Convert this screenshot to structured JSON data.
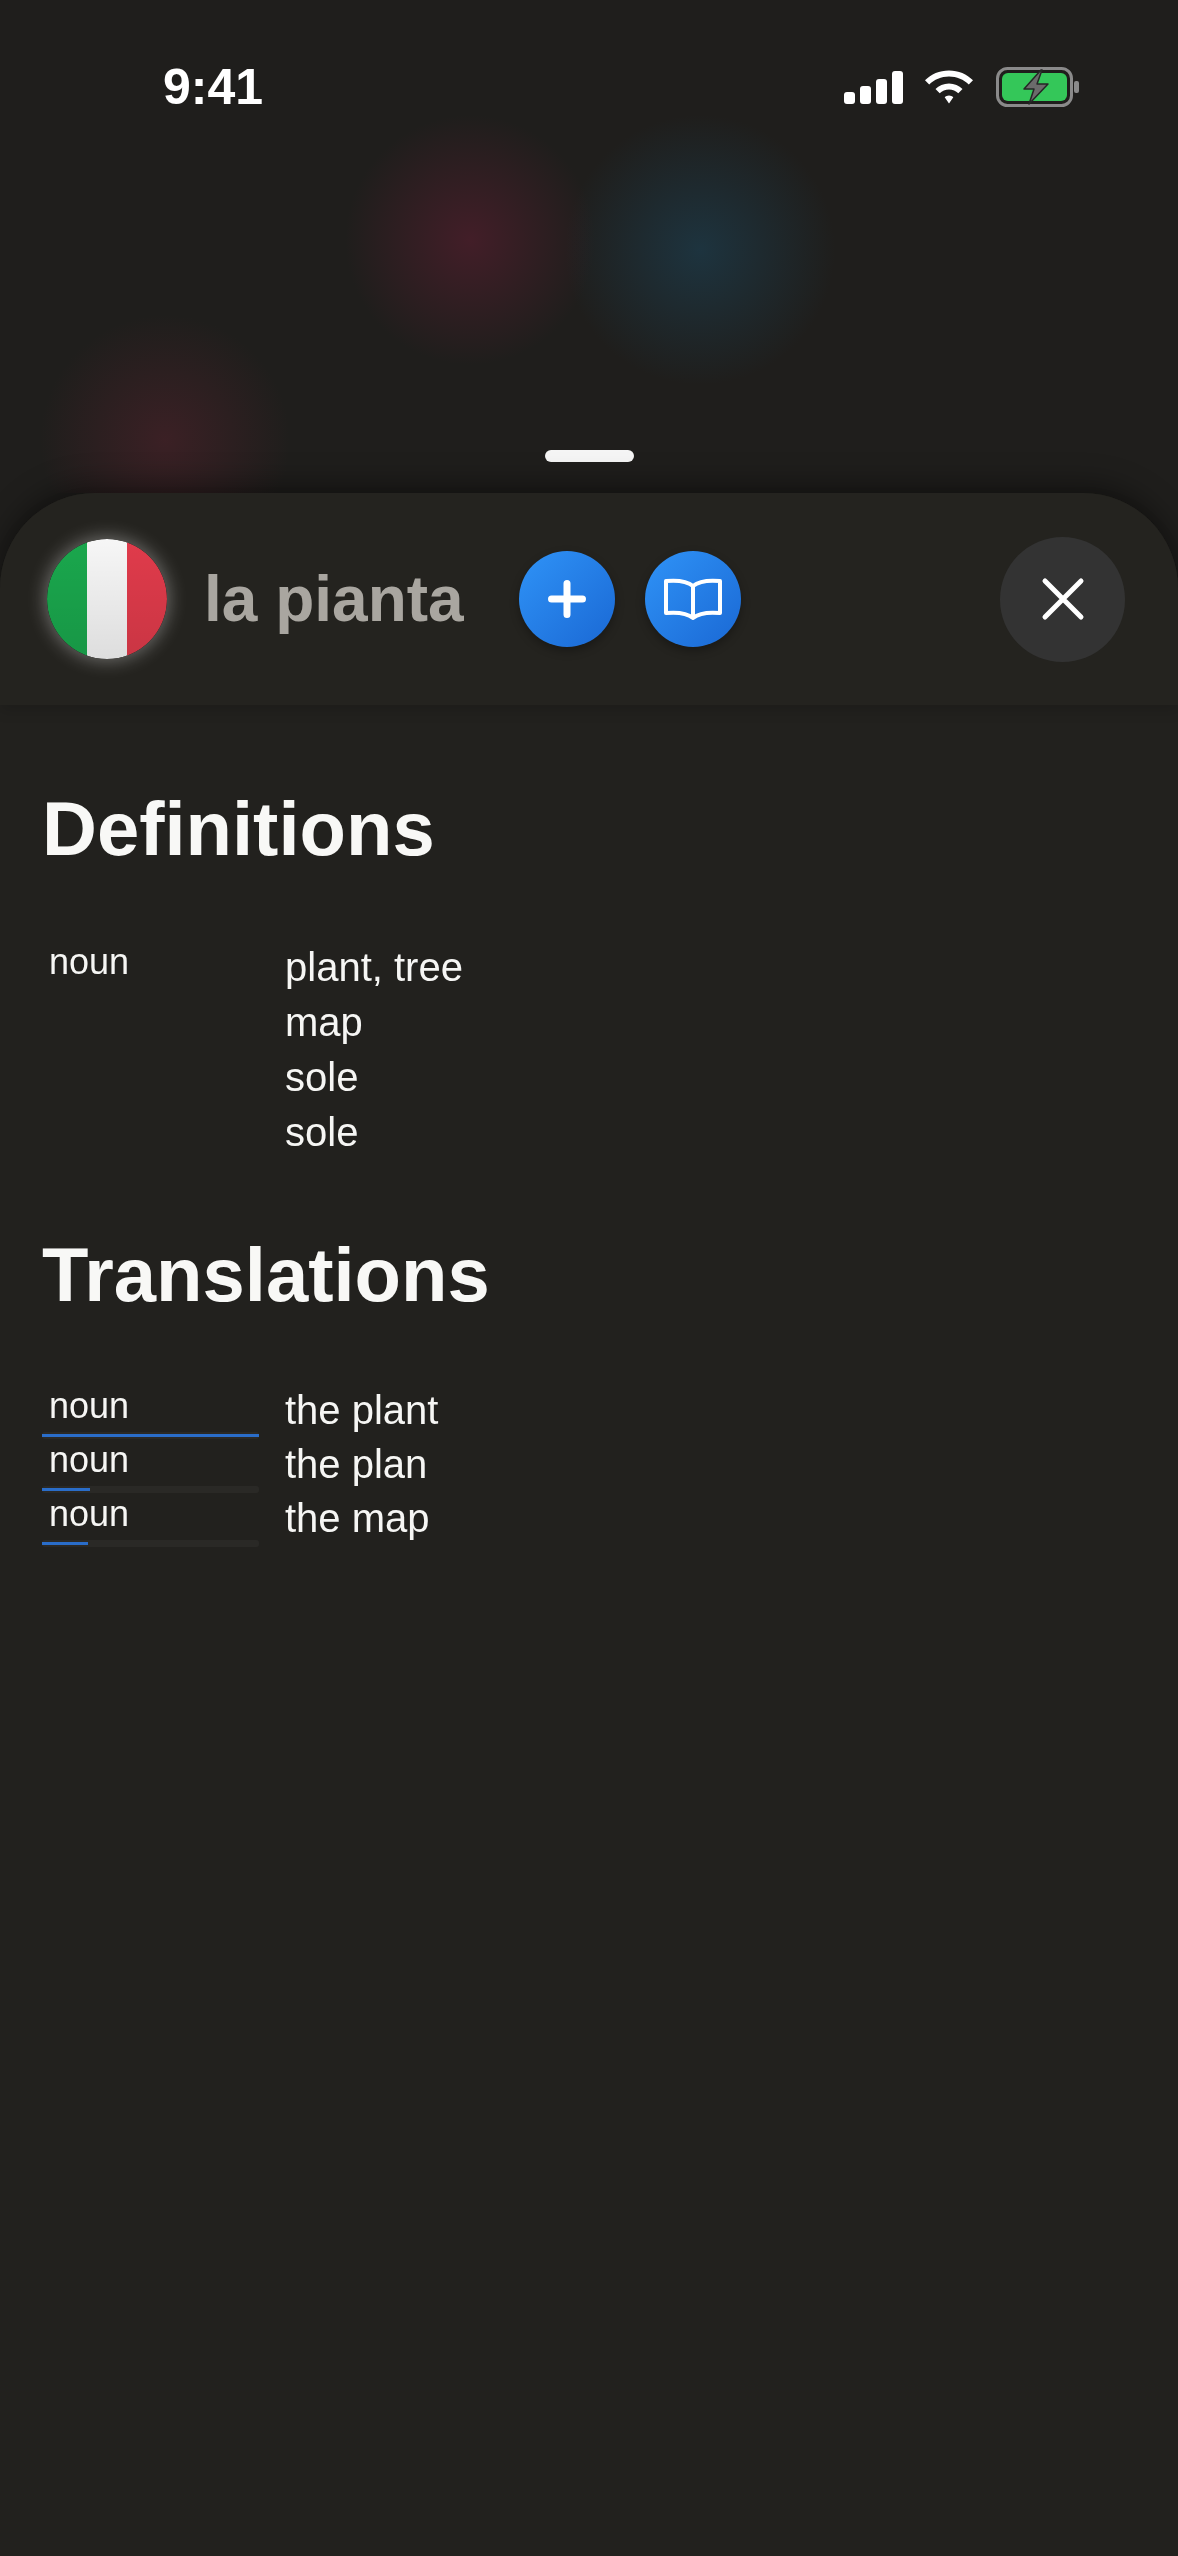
{
  "status_bar": {
    "time": "9:41"
  },
  "header": {
    "word": "la pianta"
  },
  "sections": [
    {
      "kind": "definitions",
      "title": "Definitions",
      "groups": [
        {
          "part_of_speech": "noun",
          "meanings": [
            "plant, tree",
            "map",
            "sole",
            "sole"
          ]
        }
      ]
    },
    {
      "kind": "translations",
      "title": "Translations",
      "rows": [
        {
          "part_of_speech": "noun",
          "translation": "the plant",
          "level": 1
        },
        {
          "part_of_speech": "noun",
          "translation": "the plan",
          "level": 0.22
        },
        {
          "part_of_speech": "noun",
          "translation": "the map",
          "level": 0.21
        }
      ]
    }
  ]
}
